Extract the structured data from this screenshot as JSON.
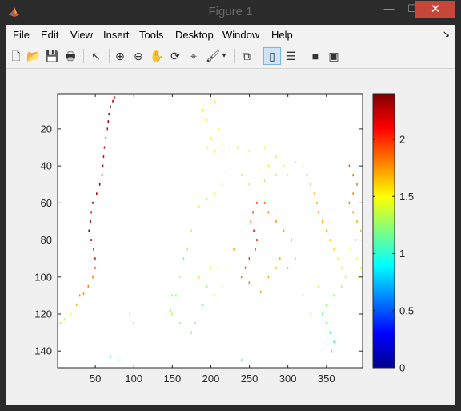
{
  "window": {
    "title": "Figure 1",
    "minimize_label": "—",
    "maximize_label": "☐",
    "close_label": "✕"
  },
  "menu": {
    "items": [
      "File",
      "Edit",
      "View",
      "Insert",
      "Tools",
      "Desktop",
      "Window",
      "Help"
    ],
    "dock_arrow": "↘"
  },
  "toolbar": {
    "buttons": [
      {
        "name": "new-figure",
        "icon": "new-file-icon",
        "glyph": "🗋"
      },
      {
        "name": "open-file",
        "icon": "folder-open-icon",
        "glyph": "📂"
      },
      {
        "name": "save-figure",
        "icon": "save-icon",
        "glyph": "💾"
      },
      {
        "name": "print-figure",
        "icon": "printer-icon",
        "glyph": "🖶"
      },
      {
        "name": "edit-plot",
        "icon": "cursor-arrow-icon",
        "glyph": "↖"
      },
      {
        "name": "zoom-in",
        "icon": "zoom-in-icon",
        "glyph": "⊕"
      },
      {
        "name": "zoom-out",
        "icon": "zoom-out-icon",
        "glyph": "⊖"
      },
      {
        "name": "pan",
        "icon": "hand-icon",
        "glyph": "✋"
      },
      {
        "name": "rotate-3d",
        "icon": "rotate-icon",
        "glyph": "⟳"
      },
      {
        "name": "data-cursor",
        "icon": "data-cursor-icon",
        "glyph": "⌖"
      },
      {
        "name": "brush",
        "icon": "brush-icon",
        "glyph": "🖌"
      },
      {
        "name": "brush-menu",
        "icon": "chevron-down-icon",
        "glyph": "▾"
      },
      {
        "name": "link-plot",
        "icon": "link-plot-icon",
        "glyph": "⧉"
      },
      {
        "name": "insert-colorbar",
        "icon": "colorbar-icon",
        "glyph": "▯"
      },
      {
        "name": "insert-legend",
        "icon": "legend-icon",
        "glyph": "☰"
      },
      {
        "name": "hide-plot-tools",
        "icon": "hide-tools-icon",
        "glyph": "■"
      },
      {
        "name": "show-plot-tools",
        "icon": "show-tools-icon",
        "glyph": "▣"
      }
    ]
  },
  "colors": {
    "window_bg": "#2b2b2b",
    "chrome_bg": "#f2f2f2",
    "figure_bg": "#f0f0f0",
    "axes_bg": "#ffffff",
    "close_red": "#c7463a",
    "pressed_blue": "#cfe3f7"
  },
  "chart_data": {
    "type": "scatter",
    "title": "",
    "xlabel": "",
    "ylabel": "",
    "xlim": [
      1,
      397
    ],
    "ylim": [
      149,
      1
    ],
    "y_reversed": true,
    "xticks": [
      50,
      100,
      150,
      200,
      250,
      300,
      350
    ],
    "yticks": [
      20,
      40,
      60,
      80,
      100,
      120,
      140
    ],
    "colormap": "jet",
    "clim": [
      0,
      2.4
    ],
    "colorbar_ticks": [
      0,
      0.5,
      1,
      1.5,
      2
    ],
    "colorbar_placement": "right",
    "grid": false,
    "series": [
      {
        "points": [
          [
            75,
            3,
            2.35
          ],
          [
            73,
            5,
            2.3
          ],
          [
            70,
            8,
            2.35
          ],
          [
            68,
            12,
            2.3
          ],
          [
            67,
            16,
            2.25
          ],
          [
            66,
            20,
            2.2
          ],
          [
            64,
            25,
            2.25
          ],
          [
            62,
            30,
            2.2
          ],
          [
            61,
            35,
            2.15
          ],
          [
            60,
            40,
            2.2
          ],
          [
            59,
            45,
            2.3
          ],
          [
            56,
            50,
            2.35
          ],
          [
            52,
            55,
            2.3
          ],
          [
            47,
            60,
            2.35
          ],
          [
            45,
            65,
            2.3
          ],
          [
            44,
            70,
            2.4
          ],
          [
            42,
            75,
            2.35
          ],
          [
            45,
            80,
            2.3
          ],
          [
            48,
            85,
            2.2
          ],
          [
            50,
            90,
            2.1
          ],
          [
            50,
            95,
            1.9
          ],
          [
            47,
            100,
            1.85
          ],
          [
            41,
            105,
            1.8
          ],
          [
            35,
            109,
            1.75
          ],
          [
            30,
            110,
            1.75
          ],
          [
            26,
            115,
            1.7
          ],
          [
            18,
            120,
            1.45
          ],
          [
            10,
            123,
            1.3
          ],
          [
            5,
            125,
            1.3
          ],
          [
            190,
            10,
            1.6
          ],
          [
            195,
            15,
            1.55
          ],
          [
            205,
            5,
            1.55
          ],
          [
            210,
            20,
            1.5
          ],
          [
            200,
            25,
            1.5
          ],
          [
            196,
            30,
            1.45
          ],
          [
            205,
            32,
            1.55
          ],
          [
            215,
            28,
            1.55
          ],
          [
            225,
            30,
            1.55
          ],
          [
            235,
            30,
            1.55
          ],
          [
            250,
            32,
            1.5
          ],
          [
            270,
            30,
            1.45
          ],
          [
            275,
            40,
            1.4
          ],
          [
            285,
            35,
            1.4
          ],
          [
            295,
            40,
            1.45
          ],
          [
            300,
            45,
            1.5
          ],
          [
            310,
            38,
            1.55
          ],
          [
            285,
            45,
            1.35
          ],
          [
            270,
            48,
            1.3
          ],
          [
            250,
            50,
            1.35
          ],
          [
            240,
            45,
            1.35
          ],
          [
            220,
            43,
            1.3
          ],
          [
            215,
            50,
            1.25
          ],
          [
            205,
            55,
            1.35
          ],
          [
            195,
            58,
            1.3
          ],
          [
            185,
            62,
            1.4
          ],
          [
            175,
            75,
            1.35
          ],
          [
            170,
            85,
            1.25
          ],
          [
            165,
            90,
            1.2
          ],
          [
            160,
            100,
            1.3
          ],
          [
            155,
            110,
            1.2
          ],
          [
            150,
            120,
            1.3
          ],
          [
            160,
            125,
            1.2
          ],
          [
            260,
            60,
            1.95
          ],
          [
            255,
            65,
            2.0
          ],
          [
            252,
            70,
            1.95
          ],
          [
            256,
            75,
            2.1
          ],
          [
            260,
            80,
            2.05
          ],
          [
            258,
            85,
            2.0
          ],
          [
            250,
            90,
            1.95
          ],
          [
            245,
            95,
            1.9
          ],
          [
            240,
            100,
            1.85
          ],
          [
            250,
            103,
            1.8
          ],
          [
            265,
            108,
            1.75
          ],
          [
            275,
            100,
            1.7
          ],
          [
            285,
            95,
            1.65
          ],
          [
            290,
            90,
            1.7
          ],
          [
            300,
            95,
            1.65
          ],
          [
            310,
            90,
            1.6
          ],
          [
            305,
            80,
            1.65
          ],
          [
            295,
            75,
            1.7
          ],
          [
            285,
            70,
            1.75
          ],
          [
            275,
            65,
            1.8
          ],
          [
            270,
            60,
            1.85
          ],
          [
            320,
            40,
            1.5
          ],
          [
            325,
            45,
            1.8
          ],
          [
            330,
            50,
            1.85
          ],
          [
            335,
            55,
            1.75
          ],
          [
            338,
            60,
            1.7
          ],
          [
            340,
            65,
            1.75
          ],
          [
            345,
            70,
            1.7
          ],
          [
            350,
            75,
            1.65
          ],
          [
            355,
            80,
            1.6
          ],
          [
            360,
            85,
            1.55
          ],
          [
            365,
            90,
            1.5
          ],
          [
            370,
            95,
            1.45
          ],
          [
            375,
            100,
            1.35
          ],
          [
            370,
            105,
            1.3
          ],
          [
            360,
            110,
            1.25
          ],
          [
            350,
            115,
            1.2
          ],
          [
            345,
            120,
            1.15
          ],
          [
            350,
            125,
            1.2
          ],
          [
            355,
            130,
            1.1
          ],
          [
            360,
            135,
            1.05
          ],
          [
            357,
            140,
            1.0
          ],
          [
            380,
            40,
            1.95
          ],
          [
            385,
            45,
            1.9
          ],
          [
            390,
            50,
            1.85
          ],
          [
            385,
            55,
            1.8
          ],
          [
            380,
            60,
            1.85
          ],
          [
            385,
            65,
            1.75
          ],
          [
            390,
            70,
            1.7
          ],
          [
            395,
            75,
            1.65
          ],
          [
            388,
            80,
            1.6
          ],
          [
            382,
            85,
            1.55
          ],
          [
            390,
            90,
            1.5
          ],
          [
            395,
            95,
            1.45
          ],
          [
            392,
            100,
            1.35
          ],
          [
            230,
            85,
            1.7
          ],
          [
            220,
            95,
            1.5
          ],
          [
            215,
            105,
            1.4
          ],
          [
            205,
            110,
            1.3
          ],
          [
            195,
            105,
            1.25
          ],
          [
            190,
            115,
            1.2
          ],
          [
            180,
            125,
            1.15
          ],
          [
            175,
            130,
            1.2
          ],
          [
            185,
            100,
            1.35
          ],
          [
            200,
            95,
            1.45
          ],
          [
            150,
            110,
            1.25
          ],
          [
            148,
            118,
            1.2
          ],
          [
            95,
            120,
            1.2
          ],
          [
            100,
            125,
            1.25
          ],
          [
            70,
            143,
            1.1
          ],
          [
            80,
            145,
            1.05
          ],
          [
            240,
            145,
            1.0
          ],
          [
            320,
            110,
            1.3
          ],
          [
            330,
            120,
            1.25
          ],
          [
            340,
            105,
            1.35
          ]
        ]
      }
    ]
  }
}
